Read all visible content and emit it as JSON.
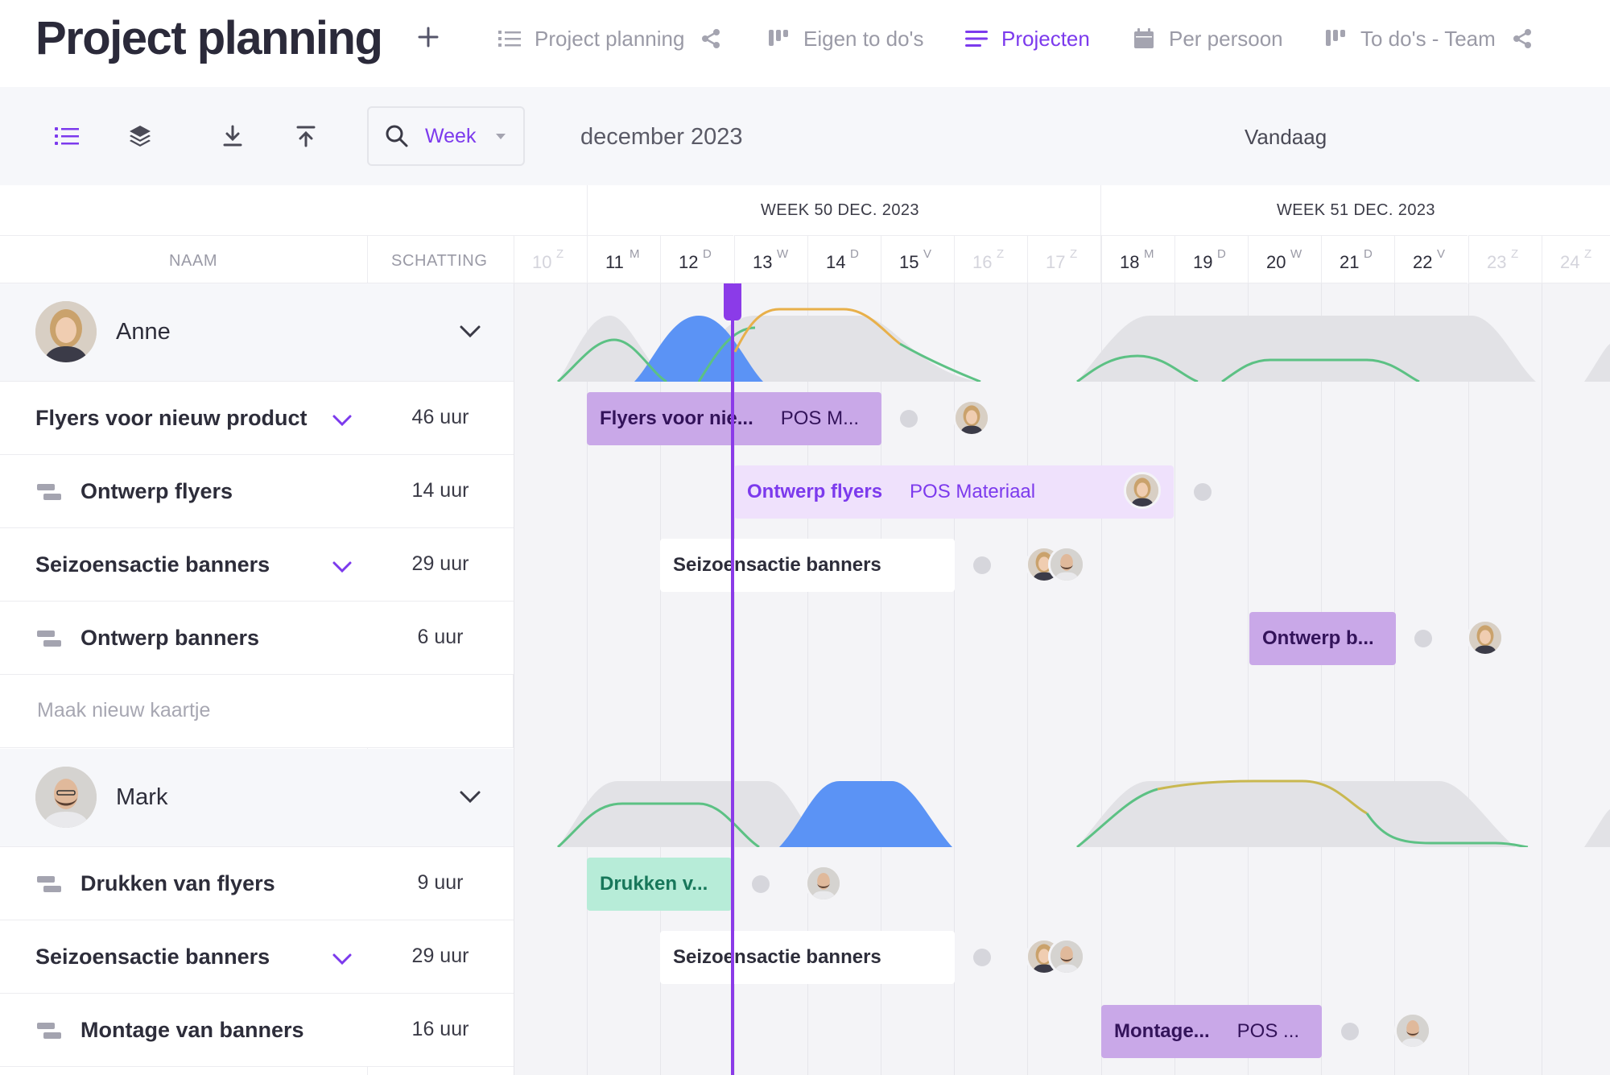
{
  "header": {
    "title": "Project planning",
    "nav": [
      {
        "label": "Project planning",
        "icon": "list-icon",
        "shared": true
      },
      {
        "label": "Eigen to do's",
        "icon": "board-icon",
        "shared": false
      },
      {
        "label": "Projecten",
        "icon": "menu-icon",
        "shared": false,
        "active": true
      },
      {
        "label": "Per persoon",
        "icon": "calendar-icon",
        "shared": false
      },
      {
        "label": "To do's - Team",
        "icon": "board-icon",
        "shared": true
      }
    ]
  },
  "toolbar": {
    "period": "Week",
    "month": "december 2023",
    "today": "Vandaag"
  },
  "columns": {
    "name": "NAAM",
    "estimate": "SCHATTING"
  },
  "weeks": [
    {
      "label": "WEEK 50 DEC. 2023"
    },
    {
      "label": "WEEK 51 DEC. 2023"
    }
  ],
  "days": [
    {
      "num": "10",
      "letter": "Z",
      "weekend": true
    },
    {
      "num": "11",
      "letter": "M",
      "weekend": false
    },
    {
      "num": "12",
      "letter": "D",
      "weekend": false
    },
    {
      "num": "13",
      "letter": "W",
      "weekend": false
    },
    {
      "num": "14",
      "letter": "D",
      "weekend": false
    },
    {
      "num": "15",
      "letter": "V",
      "weekend": false
    },
    {
      "num": "16",
      "letter": "Z",
      "weekend": true
    },
    {
      "num": "17",
      "letter": "Z",
      "weekend": true
    },
    {
      "num": "18",
      "letter": "M",
      "weekend": false
    },
    {
      "num": "19",
      "letter": "D",
      "weekend": false
    },
    {
      "num": "20",
      "letter": "W",
      "weekend": false
    },
    {
      "num": "21",
      "letter": "D",
      "weekend": false
    },
    {
      "num": "22",
      "letter": "V",
      "weekend": false
    },
    {
      "num": "23",
      "letter": "Z",
      "weekend": true
    },
    {
      "num": "24",
      "letter": "Z",
      "weekend": true
    }
  ],
  "people": [
    {
      "name": "Anne",
      "tasks": [
        {
          "name": "Flyers voor nieuw product",
          "estimate": "46 uur",
          "type": "project",
          "bar": {
            "title": "Flyers voor nie...",
            "project": "POS M...",
            "style": "purple"
          }
        },
        {
          "name": "Ontwerp flyers",
          "estimate": "14 uur",
          "type": "sub",
          "bar": {
            "title": "Ontwerp flyers",
            "project": "POS Materiaal",
            "style": "light"
          }
        },
        {
          "name": "Seizoensactie banners",
          "estimate": "29 uur",
          "type": "project",
          "bar": {
            "title": "Seizoensactie banners",
            "project": "",
            "style": "white"
          }
        },
        {
          "name": "Ontwerp banners",
          "estimate": "6 uur",
          "type": "sub",
          "bar": {
            "title": "Ontwerp b...",
            "project": "",
            "style": "purple"
          }
        }
      ],
      "new_card": "Maak nieuw kaartje"
    },
    {
      "name": "Mark",
      "tasks": [
        {
          "name": "Drukken van flyers",
          "estimate": "9 uur",
          "type": "sub",
          "bar": {
            "title": "Drukken v...",
            "project": "",
            "style": "green"
          }
        },
        {
          "name": "Seizoensactie banners",
          "estimate": "29 uur",
          "type": "project",
          "bar": {
            "title": "Seizoensactie banners",
            "project": "",
            "style": "white"
          }
        },
        {
          "name": "Montage van banners",
          "estimate": "16 uur",
          "type": "sub",
          "bar": {
            "title": "Montage...",
            "project": "POS ...",
            "style": "purple"
          }
        }
      ]
    }
  ],
  "colors": {
    "accent": "#7c3aed",
    "today_line": "#8b3be8",
    "load_blue": "#5b93f5",
    "load_green": "#5cc184",
    "load_orange": "#e8b04a"
  }
}
